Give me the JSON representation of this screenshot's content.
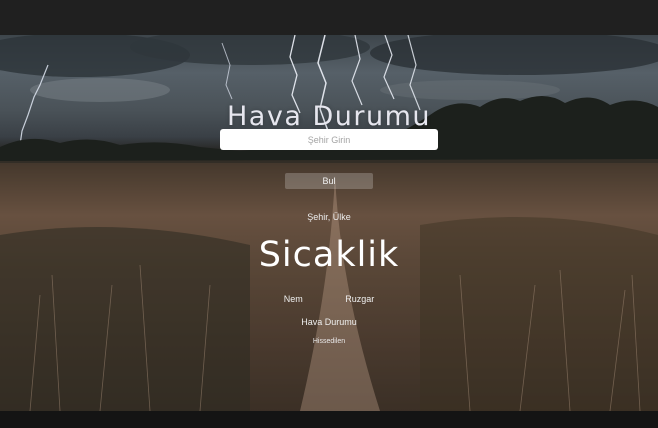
{
  "app": {
    "title": "Hava Durumu"
  },
  "search": {
    "placeholder": "Şehir Girin",
    "button_label": "Bul"
  },
  "weather": {
    "location": "Şehir, Ülke",
    "temperature": "Sicaklik",
    "humidity_label": "Nem",
    "wind_label": "Ruzgar",
    "condition": "Hava Durumu",
    "feels_like": "Hissedilen"
  },
  "colors": {
    "title_text": "#e6e6ee",
    "input_background": "#ffffff",
    "button_background": "rgba(255,255,255,0.22)",
    "top_bar": "#202020"
  }
}
